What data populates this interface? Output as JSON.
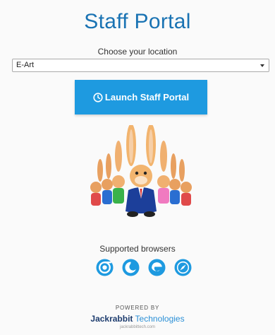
{
  "header": {
    "title": "Staff Portal"
  },
  "location": {
    "label": "Choose your location",
    "selected": "E-Art"
  },
  "launch": {
    "label": "Launch Staff Portal",
    "icon": "clock-icon"
  },
  "mascot": {
    "description": "jackrabbit-mascot-group"
  },
  "browsers": {
    "label": "Supported browsers",
    "items": [
      "chrome-icon",
      "firefox-icon",
      "edge-icon",
      "safari-icon"
    ]
  },
  "footer": {
    "powered_by": "POWERED BY",
    "brand_bold": "Jackrabbit",
    "brand_light": "Technologies",
    "site": "jackrabbittech.com"
  },
  "colors": {
    "accent": "#1e9ae0",
    "title": "#1a73b3",
    "brand_dark": "#1d3c6e",
    "brand_light": "#2a8fd6"
  }
}
